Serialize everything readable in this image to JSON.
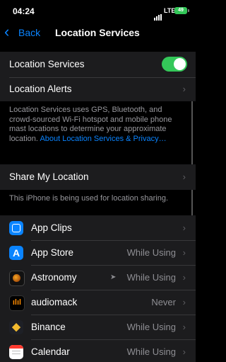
{
  "status_bar": {
    "time": "04:24",
    "network": "LTE",
    "battery": "49"
  },
  "nav": {
    "back_label": "Back",
    "title": "Location Services"
  },
  "location_services": {
    "label": "Location Services",
    "enabled": true
  },
  "location_alerts": {
    "label": "Location Alerts"
  },
  "description": {
    "text": "Location Services uses GPS, Bluetooth, and crowd-sourced Wi-Fi hotspot and mobile phone mast locations to determine your approximate location.",
    "link": "About Location Services & Privacy…"
  },
  "share_my_location": {
    "label": "Share My Location",
    "note": "This iPhone is being used for location sharing."
  },
  "apps": [
    {
      "name": "App Clips",
      "value": "",
      "icon": "app-clips-icon"
    },
    {
      "name": "App Store",
      "value": "While Using",
      "icon": "app-store-icon"
    },
    {
      "name": "Astronomy",
      "value": "While Using",
      "icon": "astronomy-icon",
      "arrow": true
    },
    {
      "name": "audiomack",
      "value": "Never",
      "icon": "audiomack-icon"
    },
    {
      "name": "Binance",
      "value": "While Using",
      "icon": "binance-icon"
    },
    {
      "name": "Calendar",
      "value": "While Using",
      "icon": "calendar-icon"
    }
  ],
  "colors": {
    "accent": "#0a84ff",
    "toggle_on": "#34c759",
    "background": "#000000",
    "cell": "#1c1c1e"
  }
}
